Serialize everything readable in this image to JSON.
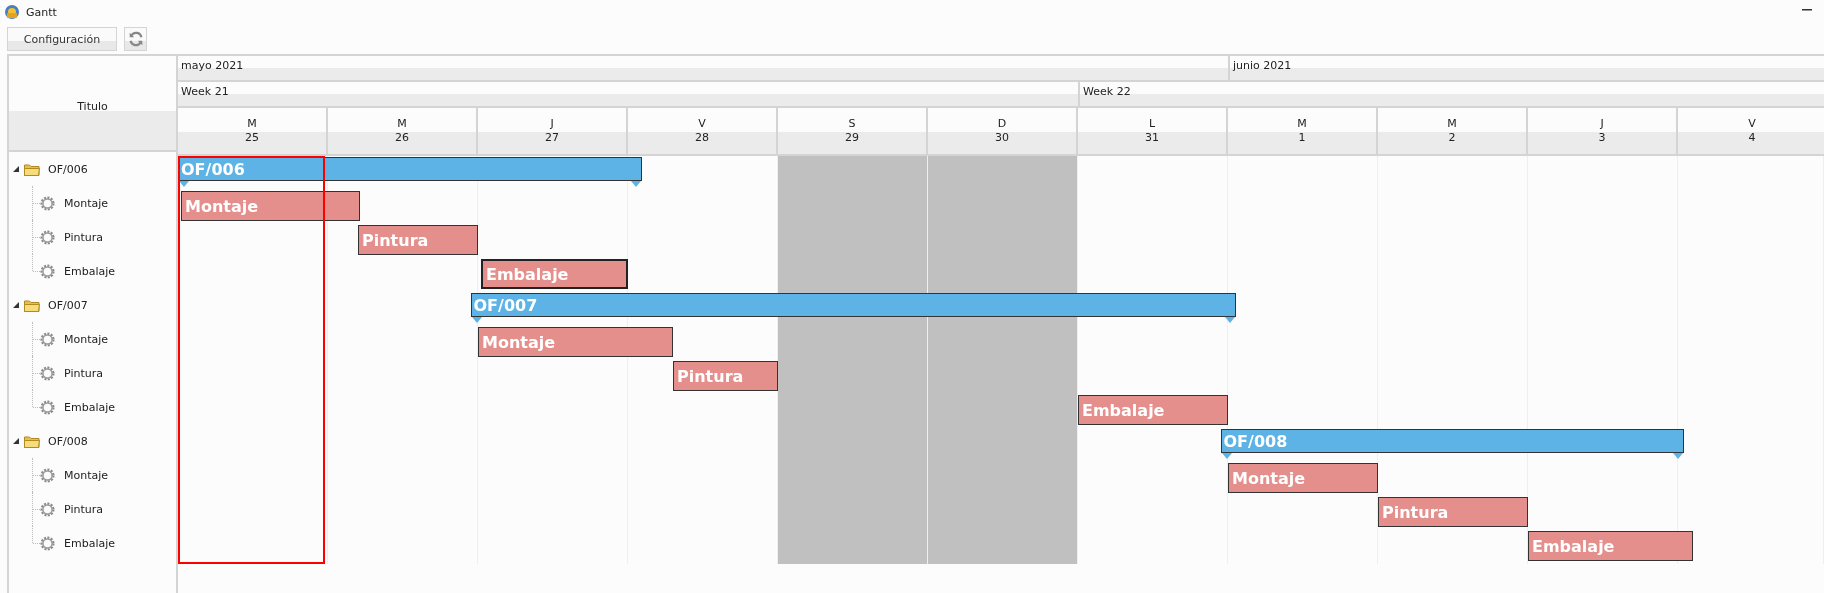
{
  "window": {
    "title": "Gantt"
  },
  "toolbar": {
    "config_button": "Configuración"
  },
  "header": {
    "title_column": "Titulo"
  },
  "months": [
    {
      "label": "mayo 2021",
      "weeks": [
        {
          "label": "Week 21",
          "days": [
            {
              "letter": "M",
              "number": "25",
              "weekend": false,
              "today": true
            },
            {
              "letter": "M",
              "number": "26",
              "weekend": false,
              "today": false
            },
            {
              "letter": "J",
              "number": "27",
              "weekend": false,
              "today": false
            },
            {
              "letter": "V",
              "number": "28",
              "weekend": false,
              "today": false
            },
            {
              "letter": "S",
              "number": "29",
              "weekend": true,
              "today": false
            },
            {
              "letter": "D",
              "number": "30",
              "weekend": true,
              "today": false
            }
          ]
        },
        {
          "label": "Week 22",
          "days": [
            {
              "letter": "L",
              "number": "31",
              "weekend": false,
              "today": false
            }
          ]
        }
      ]
    },
    {
      "label": "junio 2021",
      "weeks": [
        {
          "days": [
            {
              "letter": "M",
              "number": "1",
              "weekend": false,
              "today": false
            },
            {
              "letter": "M",
              "number": "2",
              "weekend": false,
              "today": false
            },
            {
              "letter": "J",
              "number": "3",
              "weekend": false,
              "today": false
            },
            {
              "letter": "V",
              "number": "4",
              "weekend": false,
              "today": false
            }
          ]
        }
      ]
    }
  ],
  "orders": [
    {
      "name": "OF/006",
      "bar_label": "OF/006",
      "expanded": true,
      "children": [
        {
          "name": "Montaje",
          "bar_label": "Montaje",
          "selected": false
        },
        {
          "name": "Pintura",
          "bar_label": "Pintura",
          "selected": false
        },
        {
          "name": "Embalaje",
          "bar_label": "Embalaje",
          "selected": true
        }
      ]
    },
    {
      "name": "OF/007",
      "bar_label": "OF/007",
      "expanded": true,
      "children": [
        {
          "name": "Montaje",
          "bar_label": "Montaje",
          "selected": false
        },
        {
          "name": "Pintura",
          "bar_label": "Pintura",
          "selected": false
        },
        {
          "name": "Embalaje",
          "bar_label": "Embalaje",
          "selected": false
        }
      ]
    },
    {
      "name": "OF/008",
      "bar_label": "OF/008",
      "expanded": true,
      "children": [
        {
          "name": "Montaje",
          "bar_label": "Montaje",
          "selected": false
        },
        {
          "name": "Pintura",
          "bar_label": "Pintura",
          "selected": false
        },
        {
          "name": "Embalaje",
          "bar_label": "Embalaje",
          "selected": false
        }
      ]
    }
  ]
}
